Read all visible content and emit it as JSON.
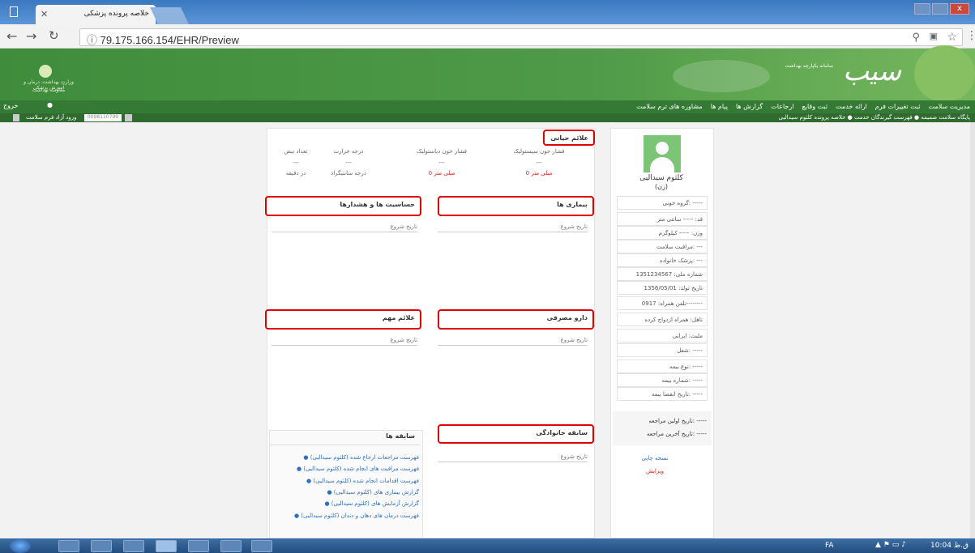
{
  "browser": {
    "tab_title": "خلاصه پرونده پزشکی",
    "url": "79.175.166.154/EHR/Preview"
  },
  "header": {
    "ministry_text": "وزارت بهداشت، درمان و آموزش پزشکی",
    "ministry_sub": "معاونت بهداشت",
    "brand": "سیب",
    "brand_sub": "سامانه یکپارچه بهداشت"
  },
  "menu": {
    "items": [
      "مدیریت سلامت",
      "ثبت تغییرات فرم",
      "ارائه خدمت",
      "ثبت وقایع",
      "ارجاعات",
      "گزارش ها",
      "پیام ها",
      "مشاوره های ترم سلامت"
    ],
    "exit": "خروج"
  },
  "submenu": {
    "text": "پایگاه سلامت ضمیمه ● فهرست گیرندگان خدمت ● خلاصه پرونده کلثوم سیدالیی",
    "right": "ورود آزاد فرم سلامت",
    "field": "0098110799"
  },
  "basic": {
    "title": "علائم حیاتی",
    "cols": [
      {
        "h": "فشار خون سیستولیک",
        "d": "---",
        "v": "0 میلی متر",
        "red": true
      },
      {
        "h": "فشار خون دیاستولیک",
        "d": "---",
        "v": "0 میلی متر",
        "red": true
      },
      {
        "h": "درجه حرارت",
        "d": "---",
        "v": "درجه سانتیگراد",
        "red": false
      },
      {
        "h": "تعداد نبض",
        "d": "---",
        "v": "در دقیقه",
        "red": false
      }
    ]
  },
  "sections": {
    "sensitivities": "حساسیت ها و هشدارها",
    "diseases": "بیماری ها",
    "signs": "علائم مهم",
    "drugs": "دارو مصرفی",
    "history": "سابقه ها",
    "family": "سابقه خانوادگی",
    "date_label": "تاریخ شروع"
  },
  "history_links": [
    "فهرست مراجعات ارجاع شده (کلثوم سیدالیی)",
    "فهرست مراقبت های انجام شده (کلثوم سیدالیی)",
    "فهرست اقدامات انجام شده (کلثوم سیدالیی)",
    "گزارش بیماری های (کلثوم سیدالیی)",
    "گزارش آزمایش های (کلثوم سیدالیی)",
    "فهرست درمان های دهان و دندان (کلثوم سیدالیی)"
  ],
  "profile": {
    "name": "کلثوم سیدالیی",
    "sub": "(زن)",
    "fields": [
      "گروه خونی: -----",
      "قد: ----- سانتی متر",
      "وزن: ----- کیلوگرم",
      "مراقبت سلامت: ---",
      "پزشک خانواده: ---",
      "شماره ملی: 1351234567",
      "تاریخ تولد: 1356/05/01",
      "تلفن همراه: 0917--------",
      "تاهل: همراه ازدواج کرده",
      "ملیت: ایرانی",
      "شغل: -----",
      "نوع بیمه: -----",
      "شماره بیمه: -----",
      "تاریخ انقضا بیمه: -----"
    ],
    "first_visit": "تاریخ اولین مراجعه: -----",
    "last_visit": "تاریخ آخرین مراجعه: -----",
    "print_link": "نسخه چاپی",
    "edit_link": "ویرایش"
  },
  "taskbar": {
    "lang": "FA",
    "time": "10:04 ق.ظ"
  }
}
